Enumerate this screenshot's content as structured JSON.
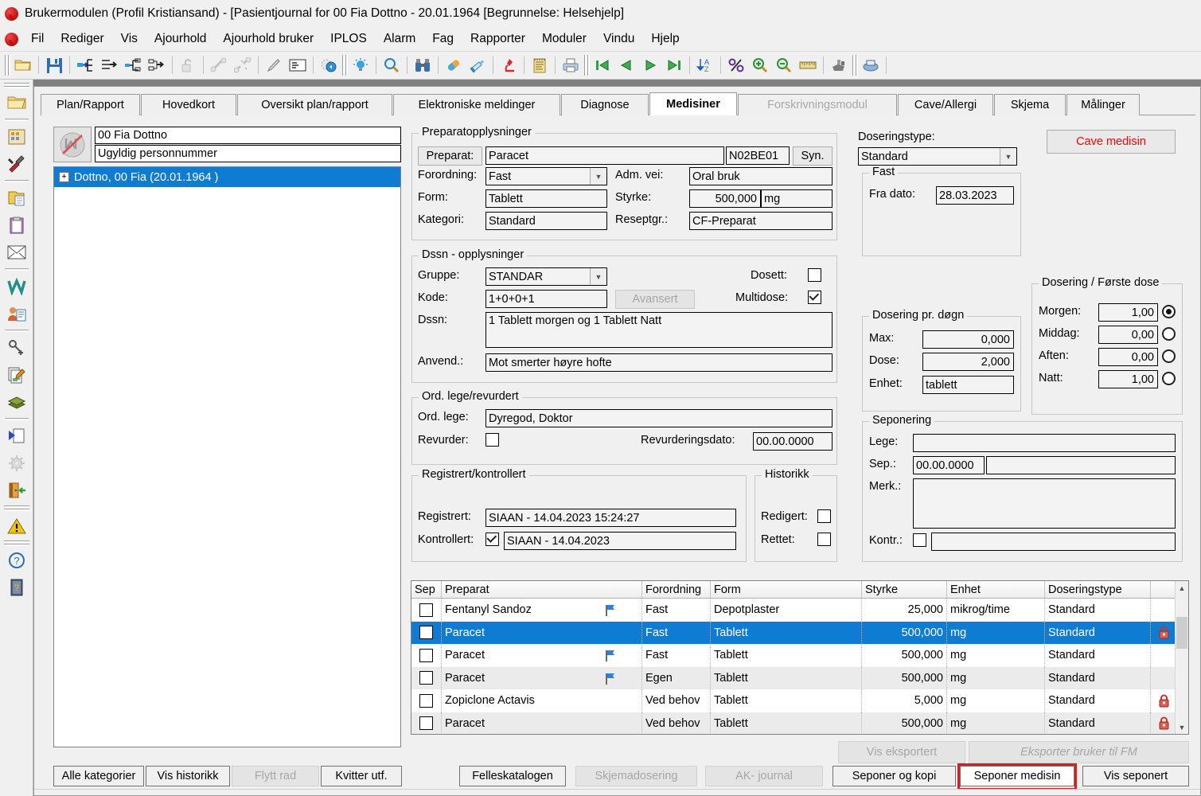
{
  "window": {
    "title": "Brukermodulen (Profil Kristiansand) - [Pasientjournal for 00 Fia Dottno - 20.01.1964   [Begrunnelse: Helsehjelp]"
  },
  "menu": {
    "items": [
      "Fil",
      "Rediger",
      "Vis",
      "Ajourhold",
      "Ajourhold bruker",
      "IPLOS",
      "Alarm",
      "Fag",
      "Rapporter",
      "Moduler",
      "Vindu",
      "Hjelp"
    ]
  },
  "toolbar": {
    "icons": [
      "open-folder-icon",
      "save-icon",
      "insert-row-icon",
      "indent-right-icon",
      "outdent-icon",
      "move-node-icon",
      "unlock-icon",
      "link-icon",
      "unlink-icon",
      "pencil-icon",
      "note-icon",
      "globe-refresh-icon",
      "lightbulb-icon",
      "search-icon",
      "binoculars-icon",
      "pill-icon",
      "syringe-icon",
      "microscope-icon",
      "journal-icon",
      "print-preview-icon",
      "first-record-icon",
      "previous-record-icon",
      "next-record-icon",
      "last-record-icon",
      "sort-az-icon",
      "percent-icon",
      "zoom-in-icon",
      "zoom-out-icon",
      "ruler-icon",
      "tools-icon",
      "printer-network-icon"
    ]
  },
  "rail": {
    "icons": [
      "open-folder-icon",
      "organization-icon",
      "tools-icon",
      "folder-document-icon",
      "clipboard-icon",
      "envelope-icon",
      "word-icon",
      "person-card-icon",
      "pushpin-icon",
      "edit-documents-icon",
      "books-icon",
      "next-page-icon",
      "gear-icon",
      "exit-door-icon",
      "warning-icon",
      "help-icon",
      "manual-icon"
    ]
  },
  "tabs": [
    {
      "label": "Plan/Rapport",
      "state": "normal"
    },
    {
      "label": "Hovedkort",
      "state": "normal"
    },
    {
      "label": "Oversikt plan/rapport",
      "state": "normal"
    },
    {
      "label": "Elektroniske meldinger",
      "state": "normal"
    },
    {
      "label": "Diagnose",
      "state": "normal"
    },
    {
      "label": "Medisiner",
      "state": "active"
    },
    {
      "label": "Forskrivningsmodul",
      "state": "disabled"
    },
    {
      "label": "Cave/Allergi",
      "state": "normal"
    },
    {
      "label": "Skjema",
      "state": "normal"
    },
    {
      "label": "Målinger",
      "state": "normal"
    }
  ],
  "patient": {
    "name": "00 Fia Dottno",
    "ssn_status": "Ugyldig personnummer",
    "tree_node": "Dottno, 00 Fia (20.01.1964 )",
    "avatar_icon": "invalid-person-icon"
  },
  "preparat_group": {
    "caption": "Preparatopplysninger",
    "preparat_button": "Preparat:",
    "preparat_value": "Paracet",
    "atc_code": "N02BE01",
    "syn_button": "Syn.",
    "forordning_label": "Forordning:",
    "forordning_value": "Fast",
    "admvei_label": "Adm. vei:",
    "admvei_value": "Oral bruk",
    "form_label": "Form:",
    "form_value": "Tablett",
    "styrke_label": "Styrke:",
    "styrke_value": "500,000",
    "styrke_unit": "mg",
    "kategori_label": "Kategori:",
    "kategori_value": "Standard",
    "reseptgr_label": "Reseptgr.:",
    "reseptgr_value": "CF-Preparat"
  },
  "dssn_group": {
    "caption": "Dssn - opplysninger",
    "gruppe_label": "Gruppe:",
    "gruppe_value": "STANDAR",
    "kode_label": "Kode:",
    "kode_value": "1+0+0+1",
    "avansert_button": "Avansert",
    "dosett_label": "Dosett:",
    "dosett_checked": false,
    "multidose_label": "Multidose:",
    "multidose_checked": true,
    "dssn_label": "Dssn:",
    "dssn_value": "1 Tablett morgen og 1 Tablett Natt",
    "anvend_label": "Anvend.:",
    "anvend_value": "Mot smerter høyre hofte"
  },
  "ordlege_group": {
    "caption": "Ord. lege/revurdert",
    "ordlege_label": "Ord. lege:",
    "ordlege_value": "Dyregod, Doktor",
    "revurder_label": "Revurder:",
    "revurder_checked": false,
    "revurderingsdato_label": "Revurderingsdato:",
    "revurderingsdato_value": "00.00.0000"
  },
  "registrert_group": {
    "caption": "Registrert/kontrollert",
    "registrert_label": "Registrert:",
    "registrert_value": "SIAAN - 14.04.2023 15:24:27",
    "kontrollert_label": "Kontrollert:",
    "kontrollert_checked": true,
    "kontrollert_value": "SIAAN - 14.04.2023"
  },
  "historikk_group": {
    "caption": "Historikk",
    "redigert_label": "Redigert:",
    "redigert_checked": false,
    "rettet_label": "Rettet:",
    "rettet_checked": false
  },
  "doseringstype": {
    "label": "Doseringstype:",
    "value": "Standard"
  },
  "cave_button": {
    "label": "Cave medisin",
    "color": "#ff0000"
  },
  "fast_group": {
    "caption": "Fast",
    "fradato_label": "Fra dato:",
    "fradato_value": "28.03.2023"
  },
  "dosering_dogn": {
    "caption": "Dosering pr. døgn",
    "max_label": "Max:",
    "max_value": "0,000",
    "dose_label": "Dose:",
    "dose_value": "2,000",
    "enhet_label": "Enhet:",
    "enhet_value": "tablett"
  },
  "dosering_forste": {
    "caption": "Dosering / Første dose",
    "rows": [
      {
        "label": "Morgen:",
        "value": "1,00",
        "selected": true
      },
      {
        "label": "Middag:",
        "value": "0,00",
        "selected": false
      },
      {
        "label": "Aften:",
        "value": "0,00",
        "selected": false
      },
      {
        "label": "Natt:",
        "value": "1,00",
        "selected": false
      }
    ]
  },
  "seponering_group": {
    "caption": "Seponering",
    "lege_label": "Lege:",
    "lege_value": "",
    "sep_label": "Sep.:",
    "sep_date": "00.00.0000",
    "sep_text": "",
    "merk_label": "Merk.:",
    "merk_value": "",
    "kontr_label": "Kontr.:",
    "kontr_checked": false,
    "kontr_value": ""
  },
  "grid": {
    "columns": [
      "Sep",
      "Preparat",
      "Forordning",
      "Form",
      "Styrke",
      "Enhet",
      "Doseringstype",
      ""
    ],
    "rows": [
      {
        "sep": false,
        "preparat": "Fentanyl Sandoz",
        "flag": true,
        "forordning": "Fast",
        "form": "Depotplaster",
        "styrke": "25,000",
        "enhet": "mikrog/time",
        "doseringstype": "Standard",
        "lock": false,
        "selected": false
      },
      {
        "sep": false,
        "preparat": "Paracet",
        "flag": false,
        "forordning": "Fast",
        "form": "Tablett",
        "styrke": "500,000",
        "enhet": "mg",
        "doseringstype": "Standard",
        "lock": true,
        "selected": true
      },
      {
        "sep": false,
        "preparat": "Paracet",
        "flag": true,
        "forordning": "Fast",
        "form": "Tablett",
        "styrke": "500,000",
        "enhet": "mg",
        "doseringstype": "Standard",
        "lock": false,
        "selected": false
      },
      {
        "sep": false,
        "preparat": "Paracet",
        "flag": true,
        "forordning": "Egen",
        "form": "Tablett",
        "styrke": "500,000",
        "enhet": "mg",
        "doseringstype": "Standard",
        "lock": false,
        "selected": false
      },
      {
        "sep": false,
        "preparat": "Zopiclone Actavis",
        "flag": false,
        "forordning": "Ved behov",
        "form": "Tablett",
        "styrke": "5,000",
        "enhet": "mg",
        "doseringstype": "Standard",
        "lock": true,
        "selected": false
      },
      {
        "sep": false,
        "preparat": "Paracet",
        "flag": false,
        "forordning": "Ved behov",
        "form": "Tablett",
        "styrke": "500,000",
        "enhet": "mg",
        "doseringstype": "Standard",
        "lock": true,
        "selected": false
      }
    ]
  },
  "bottom_buttons": {
    "alle_kategorier": "Alle kategorier",
    "vis_historikk": "Vis historikk",
    "flytt_rad": "Flytt rad",
    "kvitter_utf": "Kvitter utf.",
    "felleskatalogen": "Felleskatalogen",
    "skjemadosering": "Skjemadosering",
    "ak_journal": "AK- journal",
    "vis_eksportert": "Vis eksportert",
    "eksporter_bruker_til_fm": "Eksporter bruker til FM",
    "seponer_og_kopi": "Seponer og kopi",
    "seponer_medisin": "Seponer medisin",
    "vis_seponert": "Vis seponert"
  },
  "highlight": {
    "target": "seponer-medisin-button",
    "color": "#e01b1b"
  }
}
